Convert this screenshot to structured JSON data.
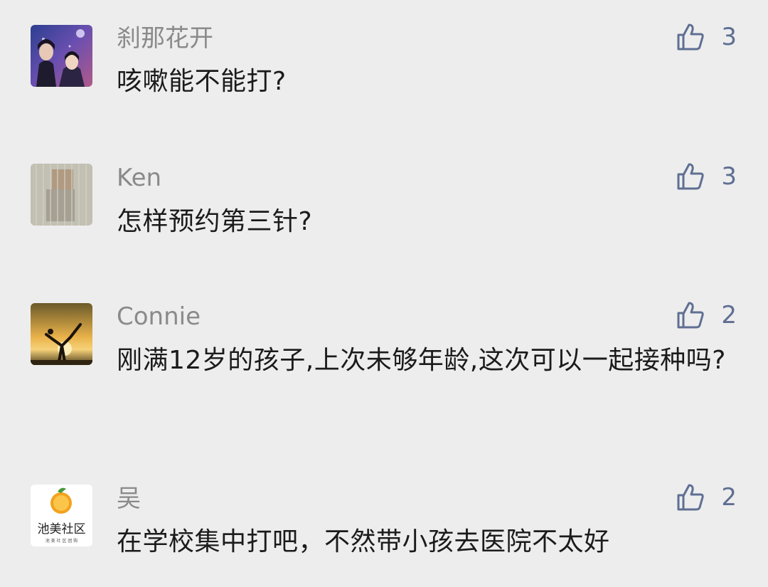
{
  "comments": [
    {
      "author": "刹那花开",
      "text": "咳嗽能不能打?",
      "likes": "3",
      "avatar": "portrait-avatar"
    },
    {
      "author": "Ken",
      "text": "怎样预约第三针?",
      "likes": "3",
      "avatar": "blurred-photo-avatar"
    },
    {
      "author": "Connie",
      "text": "刚满12岁的孩子,上次未够年龄,这次可以一起接种吗?",
      "likes": "2",
      "avatar": "sunset-yoga-avatar"
    },
    {
      "author": "吴",
      "text": "在学校集中打吧，不然带小孩去医院不太好",
      "likes": "2",
      "avatar": "community-logo-avatar",
      "avatar_text": "池美社区",
      "avatar_subtext": "池 美 社 区 团 购"
    }
  ],
  "colors": {
    "background": "#ededed",
    "author": "#8a8a8a",
    "body_text": "#1b1b1b",
    "like": "#5f6f93"
  }
}
